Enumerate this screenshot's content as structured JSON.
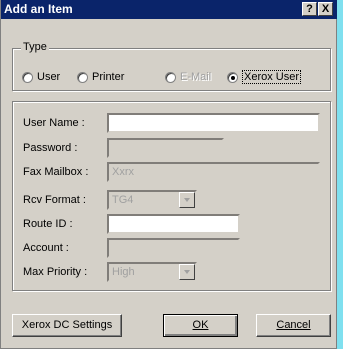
{
  "window": {
    "title": "Add an Item",
    "help_button": "?",
    "close_button": "X"
  },
  "type_group": {
    "title": "Type",
    "options": [
      {
        "label": "User",
        "selected": false,
        "enabled": true
      },
      {
        "label": "Printer",
        "selected": false,
        "enabled": true
      },
      {
        "label": "E-Mail",
        "selected": false,
        "enabled": false
      },
      {
        "label": "Xerox User",
        "selected": true,
        "enabled": true
      }
    ]
  },
  "form": {
    "user_name": {
      "label": "User Name :",
      "value": ""
    },
    "password": {
      "label": "Password :",
      "value": ""
    },
    "fax_mailbox": {
      "label": "Fax Mailbox :",
      "value": "Xxrx"
    },
    "rcv_format": {
      "label": "Rcv Format :",
      "value": "TG4"
    },
    "route_id": {
      "label": "Route ID :",
      "value": ""
    },
    "account": {
      "label": "Account :",
      "value": ""
    },
    "max_priority": {
      "label": "Max Priority :",
      "value": "High"
    }
  },
  "buttons": {
    "xerox_dc_settings": "Xerox DC Settings",
    "ok": "OK",
    "cancel": "Cancel"
  },
  "colors": {
    "titlebar": "#0a246a",
    "dialog_bg": "#d4d0c8",
    "side_strip": "#7fe0ef"
  }
}
